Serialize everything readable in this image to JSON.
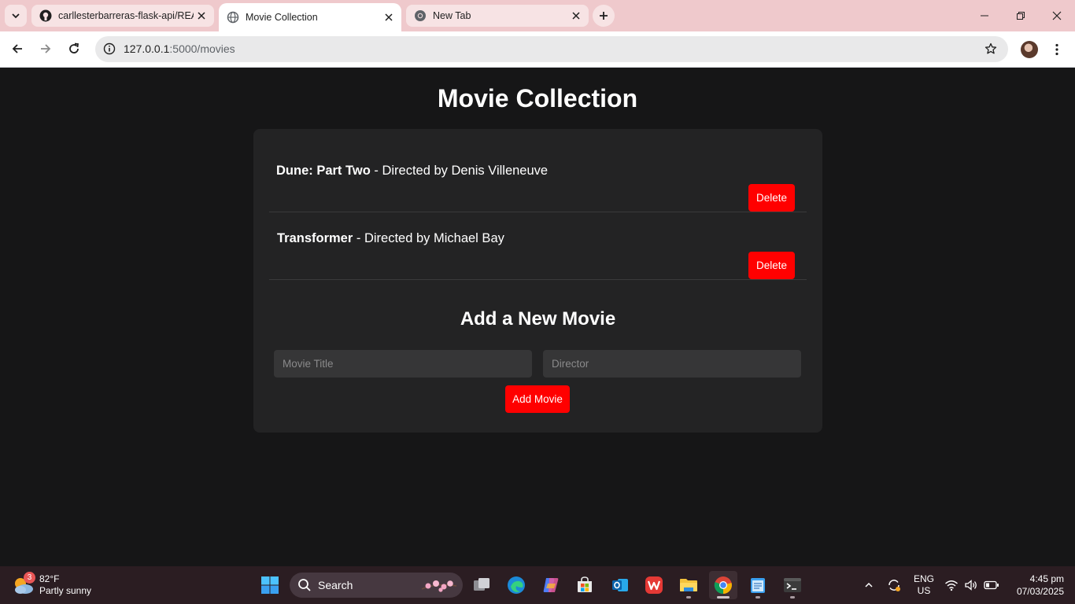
{
  "browser": {
    "tabs": [
      {
        "title": "carllesterbarreras-flask-api/README",
        "favicon": "github-icon",
        "active": false
      },
      {
        "title": "Movie Collection",
        "favicon": "globe-icon",
        "active": true
      },
      {
        "title": "New Tab",
        "favicon": "chrome-icon",
        "active": false
      }
    ],
    "url_host": "127.0.0.1",
    "url_path": ":5000/movies"
  },
  "page": {
    "title": "Movie Collection",
    "movies": [
      {
        "title": "Dune: Part Two",
        "director_text": " - Directed by Denis Villeneuve",
        "delete_label": "Delete"
      },
      {
        "title": "Transformer",
        "director_text": " - Directed by Michael Bay",
        "delete_label": "Delete"
      }
    ],
    "add_form": {
      "heading": "Add a New Movie",
      "title_placeholder": "Movie Title",
      "director_placeholder": "Director",
      "submit_label": "Add Movie"
    },
    "accent_color": "#ff0000",
    "background_color": "#161617",
    "card_color": "#232324"
  },
  "taskbar": {
    "weather": {
      "temp": "82°F",
      "condition": "Partly sunny",
      "badge": "3"
    },
    "search_label": "Search",
    "apps": [
      "start-icon",
      "search",
      "task-view-icon",
      "edge-icon",
      "copilot-icon",
      "store-icon",
      "outlook-icon",
      "wps-office-icon",
      "file-explorer-icon",
      "chrome-icon",
      "notepad-icon",
      "terminal-icon"
    ],
    "language": {
      "line1": "ENG",
      "line2": "US"
    },
    "clock": {
      "time": "4:45 pm",
      "date": "07/03/2025"
    }
  }
}
